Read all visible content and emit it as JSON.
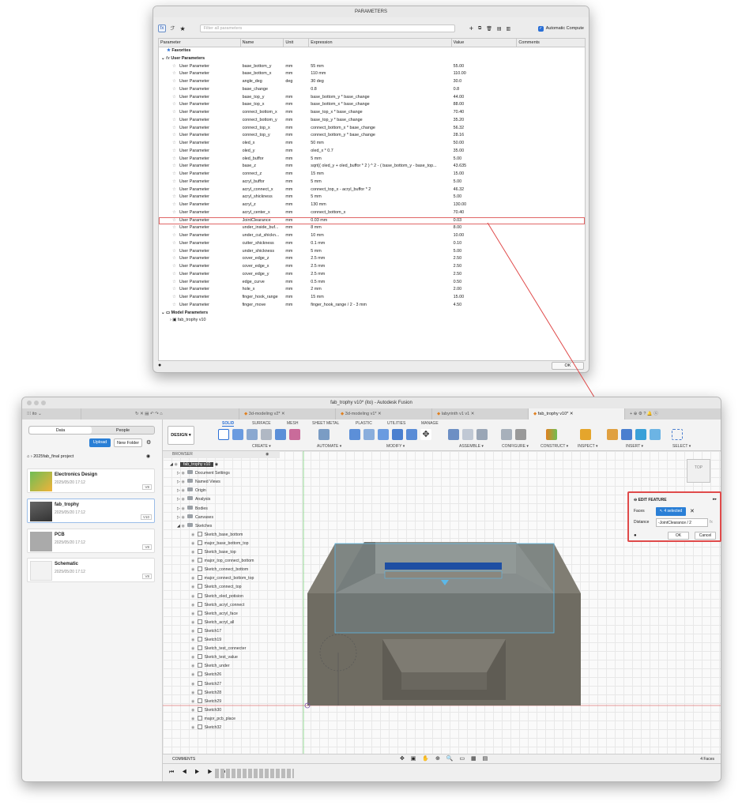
{
  "params_dialog": {
    "title": "PARAMETERS",
    "search_placeholder": "Filter all parameters",
    "auto_compute_label": "Automatic Compute",
    "headers": [
      "Parameter",
      "Name",
      "Unit",
      "Expression",
      "Value",
      "Comments"
    ],
    "favorites_label": "Favorites",
    "user_params_label": "User Parameters",
    "model_params_label": "Model Parameters",
    "model_child": "fab_trophy v10",
    "ok_label": "OK",
    "rows": [
      [
        "User Parameter",
        "base_bottom_y",
        "mm",
        "55 mm",
        "55.00"
      ],
      [
        "User Parameter",
        "base_bottom_x",
        "mm",
        "110 mm",
        "110.00"
      ],
      [
        "User Parameter",
        "angle_deg",
        "deg",
        "30 deg",
        "30.0"
      ],
      [
        "User Parameter",
        "base_change",
        "",
        "0.8",
        "0.8"
      ],
      [
        "User Parameter",
        "base_top_y",
        "mm",
        "base_bottom_y * base_change",
        "44.00"
      ],
      [
        "User Parameter",
        "base_top_x",
        "mm",
        "base_bottom_x * base_change",
        "88.00"
      ],
      [
        "User Parameter",
        "connect_bottom_x",
        "mm",
        "base_top_x * base_change",
        "70.40"
      ],
      [
        "User Parameter",
        "connect_bottom_y",
        "mm",
        "base_top_y * base_change",
        "35.20"
      ],
      [
        "User Parameter",
        "connect_top_x",
        "mm",
        "connect_bottom_x * base_change",
        "56.32"
      ],
      [
        "User Parameter",
        "connect_top_y",
        "mm",
        "connect_bottom_y * base_change",
        "28.16"
      ],
      [
        "User Parameter",
        "oled_x",
        "mm",
        "50 mm",
        "50.00"
      ],
      [
        "User Parameter",
        "oled_y",
        "mm",
        "oled_x * 0.7",
        "35.00"
      ],
      [
        "User Parameter",
        "oled_buffor",
        "mm",
        "5 mm",
        "5.00"
      ],
      [
        "User Parameter",
        "base_z",
        "mm",
        "sqrt(( oled_y + oled_buffor * 2 ) ^ 2 - ( base_bottom_y - base_top...",
        "43.635"
      ],
      [
        "User Parameter",
        "connect_z",
        "mm",
        "15 mm",
        "15.00"
      ],
      [
        "User Parameter",
        "acryl_buffor",
        "mm",
        "5 mm",
        "5.00"
      ],
      [
        "User Parameter",
        "acryl_connect_x",
        "mm",
        "connect_top_x - acryl_buffor * 2",
        "46.32"
      ],
      [
        "User Parameter",
        "acryl_shickness",
        "mm",
        "5 mm",
        "5.00"
      ],
      [
        "User Parameter",
        "acryl_z",
        "mm",
        "130 mm",
        "130.00"
      ],
      [
        "User Parameter",
        "acryl_center_x",
        "mm",
        "connect_bottom_x",
        "70.40"
      ],
      [
        "User Parameter",
        "JointClearance",
        "mm",
        "0.03 mm",
        "0.03"
      ],
      [
        "User Parameter",
        "under_inside_buf...",
        "mm",
        "8 mm",
        "8.00"
      ],
      [
        "User Parameter",
        "under_cut_shickn...",
        "mm",
        "10 mm",
        "10.00"
      ],
      [
        "User Parameter",
        "cutter_shickness",
        "mm",
        "0.1 mm",
        "0.10"
      ],
      [
        "User Parameter",
        "under_shickness",
        "mm",
        "5 mm",
        "5.00"
      ],
      [
        "User Parameter",
        "cover_edge_z",
        "mm",
        "2.5 mm",
        "2.50"
      ],
      [
        "User Parameter",
        "cover_edge_x",
        "mm",
        "2.5 mm",
        "2.50"
      ],
      [
        "User Parameter",
        "cover_edge_y",
        "mm",
        "2.5 mm",
        "2.50"
      ],
      [
        "User Parameter",
        "edge_curve",
        "mm",
        "0.5 mm",
        "0.50"
      ],
      [
        "User Parameter",
        "hole_x",
        "mm",
        "2 mm",
        "2.00"
      ],
      [
        "User Parameter",
        "finger_hook_range",
        "mm",
        "15 mm",
        "15.00"
      ],
      [
        "User Parameter",
        "finger_move",
        "mm",
        "finger_hook_range / 2 - 3 mm",
        "4.50"
      ]
    ]
  },
  "fusion": {
    "title": "fab_trophy v10* (ito) - Autodesk Fusion",
    "user": "ito",
    "tabs": [
      "3d-modeling v2*",
      "3d-modeling v1*",
      "labyrinth v1 v1",
      "fab_trophy v10*"
    ],
    "data_tab": "Data",
    "people_tab": "People",
    "upload": "Upload",
    "new_folder": "New Folder",
    "project": "2025fab_final project",
    "files": [
      {
        "name": "Electronics Design",
        "date": "2025/05/20 17:12",
        "ver": "V8"
      },
      {
        "name": "fab_trophy",
        "date": "2025/05/20 17:12",
        "ver": "V10"
      },
      {
        "name": "PCB",
        "date": "2025/05/20 17:12",
        "ver": "V8"
      },
      {
        "name": "Schematic",
        "date": "2025/05/20 17:12",
        "ver": "V8"
      }
    ],
    "design": "DESIGN",
    "ribbon_tabs": [
      "SOLID",
      "SURFACE",
      "MESH",
      "SHEET METAL",
      "PLASTIC",
      "UTILITIES",
      "MANAGE"
    ],
    "groups": [
      "CREATE",
      "AUTOMATE",
      "MODIFY",
      "ASSEMBLE",
      "CONFIGURE",
      "CONSTRUCT",
      "INSPECT",
      "INSERT",
      "SELECT"
    ],
    "browser_label": "BROWSER",
    "root": "fab_trophy v10",
    "nodes": [
      "Document Settings",
      "Named Views",
      "Origin",
      "Analysis",
      "Bodies",
      "Canvases",
      "Sketches"
    ],
    "sketches": [
      "Sketch_base_bottom",
      "major_base_bottom_top",
      "Sketch_base_top",
      "major_top_connect_bottom",
      "Sketch_connect_bottom",
      "major_connect_bottom_top",
      "Sketch_connect_top",
      "Sketch_oled_potision",
      "Sketch_acryl_connect",
      "Sketch_acryl_face",
      "Sketch_acryl_all",
      "Sketch17",
      "Sketch19",
      "Sketch_test_connecter",
      "Sketch_test_value",
      "Sketch_under",
      "Sketch26",
      "Sketch27",
      "Sketch28",
      "Sketch29",
      "Sketch30",
      "major_pcb_place",
      "Sketch32"
    ],
    "comments": "COMMENTS",
    "faces": "4 Faces",
    "viewcube": "TOP",
    "edit": {
      "title": "EDIT FEATURE",
      "faces_label": "Faces",
      "faces_value": "4 selected",
      "distance_label": "Distance",
      "distance_value": "-JointClearance / 2",
      "fx": "fx",
      "ok": "OK",
      "cancel": "Cancel"
    }
  }
}
